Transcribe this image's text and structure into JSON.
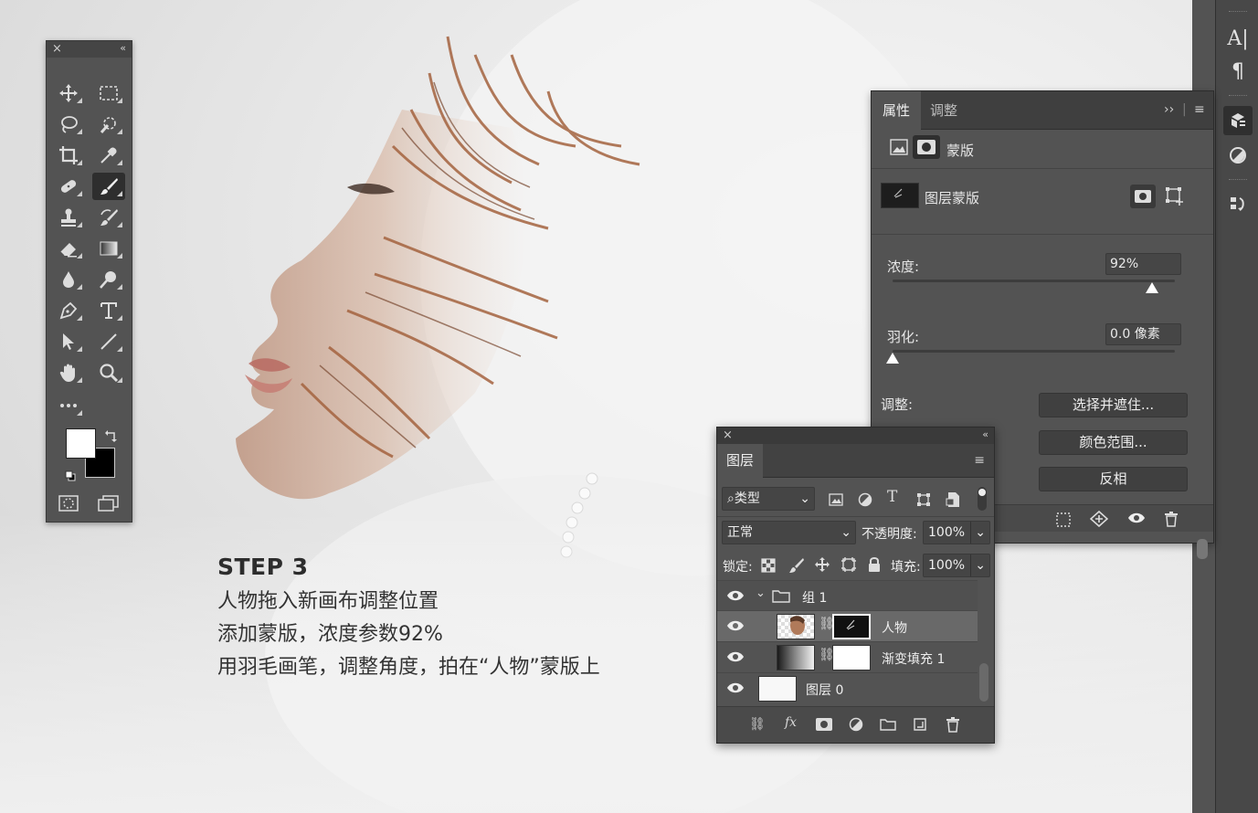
{
  "step": {
    "title": "STEP 3",
    "lines": [
      "人物拖入新画布调整位置",
      "添加蒙版，浓度参数92%",
      "用羽毛画笔，调整角度，拍在“人物”蒙版上"
    ]
  },
  "toolbar": {
    "tools": [
      "move",
      "marquee",
      "lasso",
      "quick-select",
      "crop",
      "eyedropper",
      "healing",
      "brush",
      "stamp",
      "history-brush",
      "eraser",
      "gradient",
      "blur",
      "dodge",
      "pen",
      "type",
      "path-select",
      "line",
      "hand",
      "zoom",
      "more"
    ],
    "selected_tool": "brush",
    "foreground_color": "#ffffff",
    "background_color": "#000000"
  },
  "dock": {
    "items": [
      "character-icon",
      "paragraph-icon",
      "properties-icon",
      "adjustments-icon",
      "history-icon"
    ],
    "char_glyph": "A|",
    "para_glyph": "¶"
  },
  "properties": {
    "tabs": [
      "属性",
      "调整"
    ],
    "active_tab": "属性",
    "section": "蒙版",
    "mask_label": "图层蒙版",
    "density_label": "浓度:",
    "density_value": "92%",
    "density_level": 0.92,
    "feather_label": "羽化:",
    "feather_value": "0.0 像素",
    "feather_level": 0.0,
    "adjust_label": "调整:",
    "buttons": [
      "选择并遮住...",
      "颜色范围...",
      "反相"
    ]
  },
  "layers": {
    "tab": "图层",
    "filter_label": "类型",
    "blend_mode": "正常",
    "opacity_label": "不透明度:",
    "opacity_value": "100%",
    "lock_label": "锁定:",
    "fill_label": "填充:",
    "fill_value": "100%",
    "rows": [
      {
        "name": "组 1",
        "type": "group"
      },
      {
        "name": "人物",
        "type": "layer",
        "selected": true
      },
      {
        "name": "渐变填充 1",
        "type": "fill"
      },
      {
        "name": "图层 0",
        "type": "layer"
      }
    ],
    "footer_icons": [
      "link-icon",
      "fx-icon",
      "mask-icon",
      "adjustment-icon",
      "folder-icon",
      "new-layer-icon",
      "trash-icon"
    ],
    "fx_glyph": "fx"
  }
}
